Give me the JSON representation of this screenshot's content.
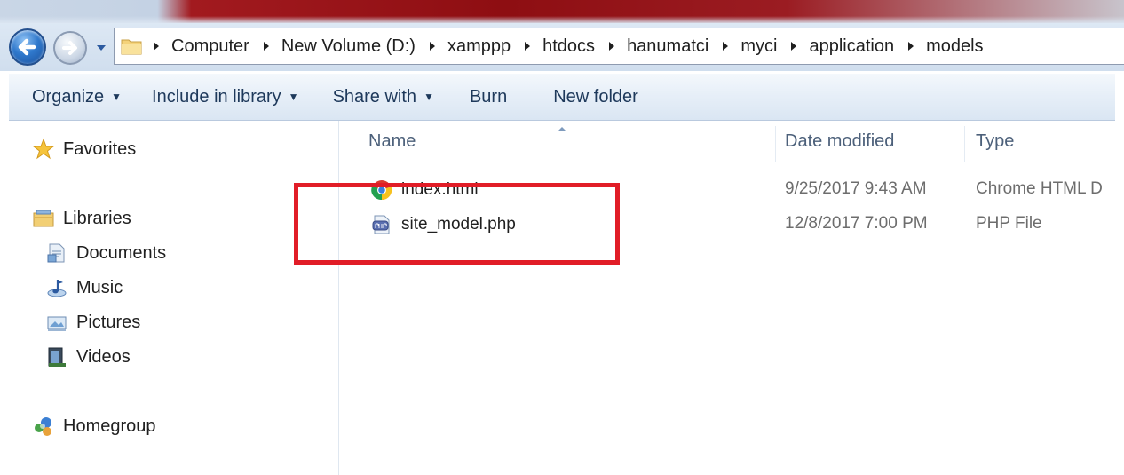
{
  "nav": {
    "back_icon": "back-arrow-icon",
    "forward_icon": "forward-arrow-icon",
    "recent_icon": "chevron-down-icon",
    "address_folder_icon": "folder-icon"
  },
  "address": {
    "crumbs": [
      "Computer",
      "New Volume (D:)",
      "xamppp",
      "htdocs",
      "hanumatci",
      "myci",
      "application",
      "models"
    ]
  },
  "toolbar": {
    "organize": "Organize",
    "include_in_library": "Include in library",
    "share_with": "Share with",
    "burn": "Burn",
    "new_folder": "New folder"
  },
  "sidebar": {
    "favorites": "Favorites",
    "libraries": "Libraries",
    "documents": "Documents",
    "music": "Music",
    "pictures": "Pictures",
    "videos": "Videos",
    "homegroup": "Homegroup"
  },
  "columns": {
    "name": "Name",
    "date_modified": "Date modified",
    "type": "Type"
  },
  "files": [
    {
      "name": "index.html",
      "date": "9/25/2017 9:43 AM",
      "type": "Chrome HTML D",
      "icon": "chrome-icon"
    },
    {
      "name": "site_model.php",
      "date": "12/8/2017 7:00 PM",
      "type": "PHP File",
      "icon": "php-file-icon"
    }
  ],
  "colors": {
    "highlight": "#e11d27",
    "toolbar_text": "#1e395b"
  }
}
